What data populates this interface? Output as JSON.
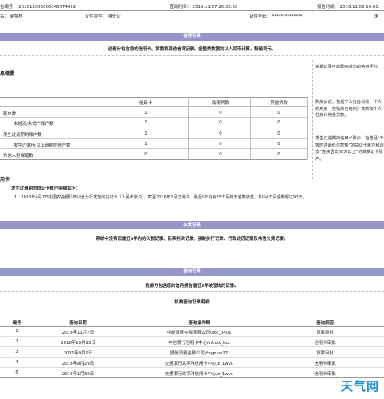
{
  "header": {
    "report_no": "告编号：  2016110000003435T4492",
    "query_time": "查询时间：  2016.11.07  20:33:20",
    "report_time": "报告时间：  2016.11.08  10:00:",
    "name": "名：  谢梦林",
    "id_type": "证件类型：  身份证",
    "id_no": "证件号码：  **************",
    "marital": "未"
  },
  "credit_section": {
    "title": "信贷记录",
    "subtitle": "这部分包含您的信用卡、贷款和其他信贷记录。金额类数据均以人民币计算，精确到元。",
    "summary_title": "息概要",
    "columns": [
      "信用卡",
      "购房贷款",
      "其他贷款"
    ],
    "rows": [
      {
        "label": "账户数",
        "values": [
          "1",
          "0",
          "0"
        ]
      },
      {
        "label": "未结清/未销户账户数",
        "values": [
          "1",
          "0",
          "0"
        ]
      },
      {
        "label": "发生过逾期的账户数",
        "values": [
          "1",
          "0",
          "0"
        ]
      },
      {
        "label": "发生过90天以上逾期的账户数",
        "values": [
          "1",
          "0",
          "0"
        ]
      },
      {
        "label": "为他人担保笔数",
        "values": [
          "0",
          "0",
          "0"
        ]
      }
    ],
    "card_heading": "用卡",
    "detail_heading": "发生过逾期的贷记卡账户明细如下：",
    "detail_item": "1、2013年4月7日中国农业银行四川省分行发放的贷记卡（人民币账户），截至2016年2月已销户。最近5年内有25个月处于逾期状态，其中4个月逾期超过90天。"
  },
  "sidebar": {
    "note1": "逾期记录可能影响对您的信用评价。",
    "note2": "购房贷款，包括个人住房贷款、个人商用房（包括商住两用）贷款和个人住房公积金贷款。",
    "note3": "发生过逾期的信用卡账户，指曾经“未按时还最低还款额”的贷记卡账户和透支“连续透支60天以上”的准贷记卡账户。"
  },
  "public_section": {
    "title": "公共记录",
    "subtitle": "系统中没有您最近5年内的欠税记录、民事判决记录、强制执行记录、行政处罚记录及电信欠费记录。"
  },
  "query_section": {
    "title": "查询记录",
    "subtitle": "这部分包含您的信用报告最近2年被查询的记录。",
    "table_title": "机构查询记录明细",
    "columns": [
      "编号",
      "查询日期",
      "查询操作员",
      "查询原因"
    ],
    "rows": [
      [
        "1",
        "2016年11月7日",
        "中邮消费金融有限公司/zxc_0401",
        "贷款审批"
      ],
      [
        "2",
        "2016年10月23日",
        "中信银行信用卡中心/citicix_kzz",
        "信用卡审批"
      ],
      [
        "3",
        "2016年9月9日",
        "捷信消费金融公司/*ngxivy37",
        "贷款审批"
      ],
      [
        "4",
        "2016年8月29日",
        "交通银行太平洋信用卡中心/z_1wvu",
        "信用卡审批"
      ],
      [
        "5",
        "2016年1月30日",
        "交通银行太平洋信用卡中心/z_1wvu",
        "信用卡审批"
      ]
    ]
  },
  "watermark": {
    "text": "天气网"
  }
}
